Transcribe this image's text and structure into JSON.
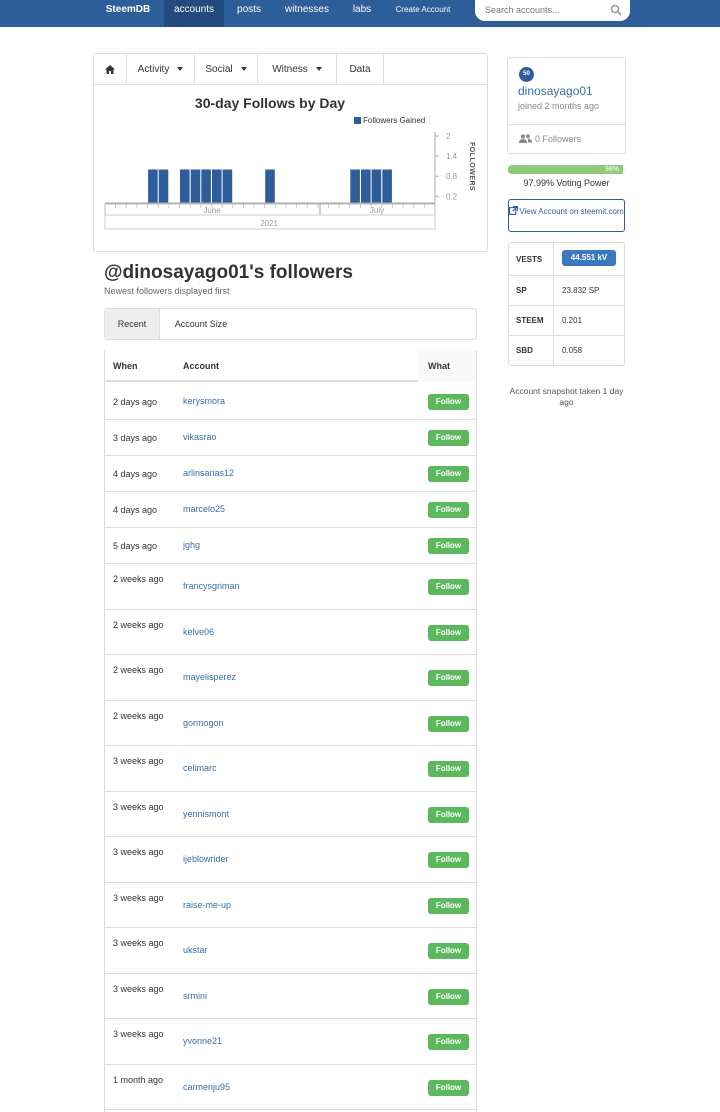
{
  "nav": {
    "brand": "SteemDB",
    "items": [
      "accounts",
      "posts",
      "witnesses",
      "labs",
      "Create Account"
    ],
    "search_placeholder": "Search accounts..."
  },
  "chart_tabs": [
    "Activity",
    "Social",
    "Witness",
    "Data"
  ],
  "chart_data": {
    "type": "bar",
    "title": "30-day Follows by Day",
    "series": [
      {
        "name": "Followers Gained",
        "values": [
          0,
          0,
          0,
          0,
          1,
          1,
          0,
          1,
          1,
          1,
          1,
          1,
          0,
          0,
          0,
          1,
          0,
          0,
          0,
          0,
          0,
          0,
          0,
          1,
          1,
          1,
          1,
          0,
          0,
          0,
          0
        ]
      }
    ],
    "ylabel": "FOLLOWERS",
    "yticks": [
      "2",
      "1.4",
      "0.8",
      "0.2"
    ],
    "ylim": [
      0,
      2
    ],
    "xticks": [
      "June",
      "July"
    ],
    "year_label": "2021",
    "grid": false,
    "legend": "top-right",
    "color": "#2e5e9a"
  },
  "page": {
    "title": "@dinosayago01's followers",
    "subtitle": "Newest followers displayed first",
    "sort_tabs": [
      "Recent",
      "Account Size"
    ],
    "columns": [
      "When",
      "Account",
      "What"
    ],
    "rows": [
      {
        "when": "2 days ago",
        "account": "kerysmora",
        "what": "Follow"
      },
      {
        "when": "3 days ago",
        "account": "vikasrao",
        "what": "Follow"
      },
      {
        "when": "4 days ago",
        "account": "arlinsarias12",
        "what": "Follow"
      },
      {
        "when": "4 days ago",
        "account": "marcelo25",
        "what": "Follow"
      },
      {
        "when": "5 days ago",
        "account": "jghg",
        "what": "Follow"
      },
      {
        "when": "2 weeks ago",
        "account": "francysgriman",
        "what": "Follow"
      },
      {
        "when": "2 weeks ago",
        "account": "kelve06",
        "what": "Follow"
      },
      {
        "when": "2 weeks ago",
        "account": "mayelisperez",
        "what": "Follow"
      },
      {
        "when": "2 weeks ago",
        "account": "gormogon",
        "what": "Follow"
      },
      {
        "when": "3 weeks ago",
        "account": "celimarc",
        "what": "Follow"
      },
      {
        "when": "3 weeks ago",
        "account": "yennismont",
        "what": "Follow"
      },
      {
        "when": "3 weeks ago",
        "account": "ijeblowrider",
        "what": "Follow"
      },
      {
        "when": "3 weeks ago",
        "account": "raise-me-up",
        "what": "Follow"
      },
      {
        "when": "3 weeks ago",
        "account": "ukstar",
        "what": "Follow"
      },
      {
        "when": "3 weeks ago",
        "account": "srmini",
        "what": "Follow"
      },
      {
        "when": "3 weeks ago",
        "account": "yvonne21",
        "what": "Follow"
      },
      {
        "when": "1 month ago",
        "account": "carmenju95",
        "what": "Follow"
      }
    ]
  },
  "profile": {
    "reputation": "50",
    "name": "dinosayago01",
    "joined": "joined 2 months ago",
    "followers": "0 Followers",
    "voting_power_pct": 97.99,
    "voting_power_bar_label": "98%",
    "voting_power_text": "97.99% Voting Power",
    "view_account": "View Account on steemit.com"
  },
  "stats": [
    {
      "label": "VESTS",
      "value": "44.551 kV"
    },
    {
      "label": "SP",
      "value": "23.832 SP"
    },
    {
      "label": "STEEM",
      "value": "0.201"
    },
    {
      "label": "SBD",
      "value": "0.058"
    }
  ],
  "snapshot": "Account snapshot taken 1 day ago"
}
